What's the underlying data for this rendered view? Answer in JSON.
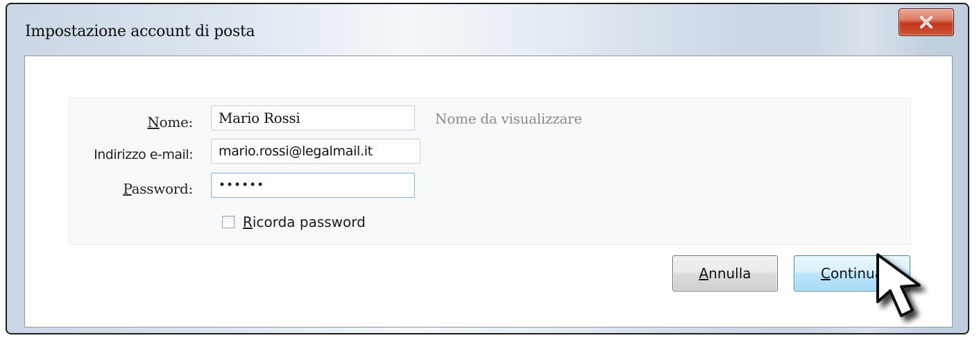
{
  "window": {
    "title": "Impostazione account di posta"
  },
  "form": {
    "name": {
      "label_accel": "N",
      "label_rest": "ome:",
      "value": "Mario Rossi",
      "hint": "Nome da visualizzare"
    },
    "email": {
      "label": "Indirizzo e-mail:",
      "value": "mario.rossi@legalmail.it"
    },
    "password": {
      "label_accel": "P",
      "label_rest": "assword:",
      "value": "••••••"
    },
    "remember": {
      "label_accel": "R",
      "label_rest": "icorda password",
      "checked": false
    }
  },
  "buttons": {
    "cancel": {
      "accel": "A",
      "rest": "nnulla"
    },
    "continue": {
      "accel": "C",
      "rest": "ontinua"
    }
  },
  "colors": {
    "close_button": "#c2361c",
    "continue_button": "#bee6fd",
    "focus_border": "#7eb4ea"
  },
  "icons": {
    "close": "close-icon",
    "cursor": "mouse-pointer-icon"
  }
}
